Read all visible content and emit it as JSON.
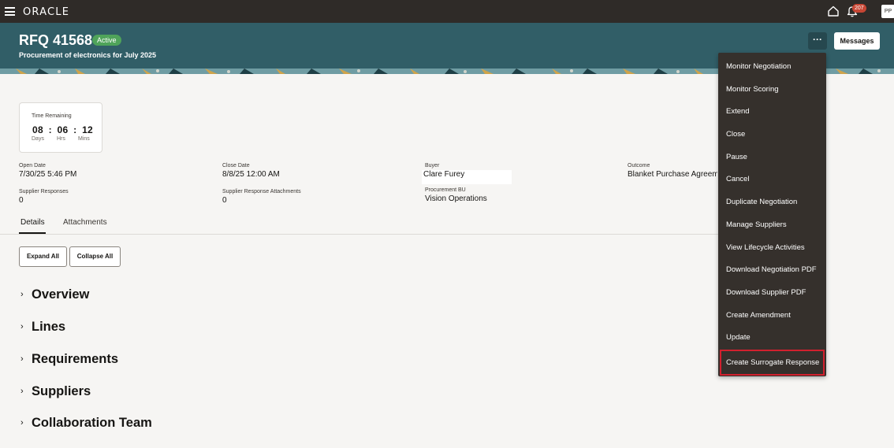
{
  "topbar": {
    "logo": "ORACLE",
    "notification_count": "207",
    "avatar_initials": "PP"
  },
  "header": {
    "title": "RFQ 41568",
    "status": "Active",
    "subtitle": "Procurement of electronics for July 2025",
    "more_label": "···",
    "messages_label": "Messages"
  },
  "time_remaining": {
    "label": "Time Remaining",
    "days": "08",
    "hours": "06",
    "mins": "12",
    "sep": ":",
    "days_unit": "Days",
    "hours_unit": "Hrs",
    "mins_unit": "Mins"
  },
  "fields": {
    "open_date_label": "Open Date",
    "open_date": "7/30/25 5:46 PM",
    "close_date_label": "Close Date",
    "close_date": "8/8/25 12:00 AM",
    "buyer_label": "Buyer",
    "buyer": "Clare Furey",
    "outcome_label": "Outcome",
    "outcome": "Blanket Purchase Agreeme",
    "supplier_responses_label": "Supplier Responses",
    "supplier_responses": "0",
    "attachments_label": "Supplier Response Attachments",
    "attachments": "0",
    "procurement_bu_label": "Procurement BU",
    "procurement_bu": "Vision Operations"
  },
  "tabs": [
    "Details",
    "Attachments"
  ],
  "buttons": {
    "expand_all": "Expand All",
    "collapse_all": "Collapse All"
  },
  "sections": [
    "Overview",
    "Lines",
    "Requirements",
    "Suppliers",
    "Collaboration Team"
  ],
  "menu": [
    "Monitor Negotiation",
    "Monitor Scoring",
    "Extend",
    "Close",
    "Pause",
    "Cancel",
    "Duplicate Negotiation",
    "Manage Suppliers",
    "View Lifecycle Activities",
    "Download Negotiation PDF",
    "Download Supplier PDF",
    "Create Amendment",
    "Update",
    "Create Surrogate Response"
  ],
  "colors": {
    "topbar": "#2f2b28",
    "header": "#315e67",
    "status_badge": "#4fa35a",
    "menu_bg": "#35302c",
    "highlight_border": "#d2202e"
  }
}
